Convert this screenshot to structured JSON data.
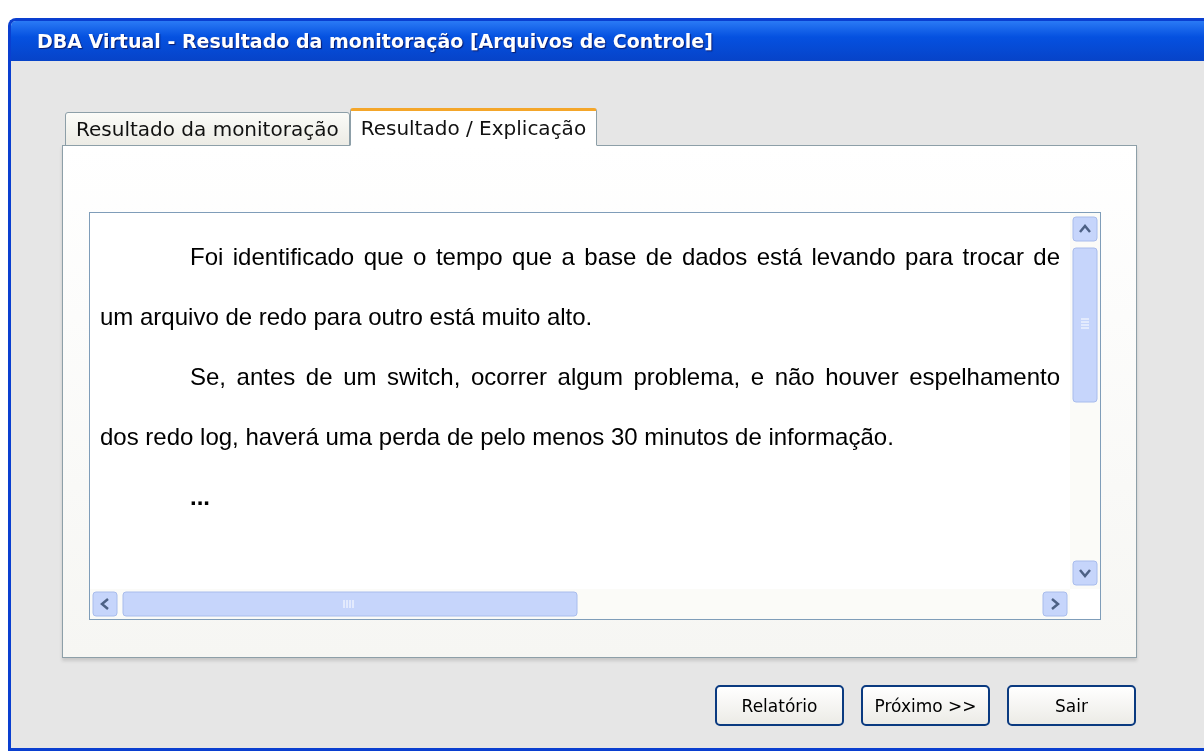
{
  "window": {
    "title": "DBA Virtual - Resultado da monitoração [Arquivos de Controle]"
  },
  "tabs": [
    {
      "label": "Resultado da monitoração",
      "selected": false
    },
    {
      "label": "Resultado / Explicação",
      "selected": true
    }
  ],
  "document": {
    "paragraphs": [
      "Foi identificado que o tempo que a base de dados está levando para trocar de um arquivo de redo para outro está muito alto.",
      "Se, antes de um switch, ocorrer algum problema, e não houver espelhamento dos redo log, haverá uma perda de pelo menos 30 minutos de informação.",
      "..."
    ]
  },
  "buttons": [
    "Relatório",
    "Próximo >>",
    "Sair"
  ]
}
